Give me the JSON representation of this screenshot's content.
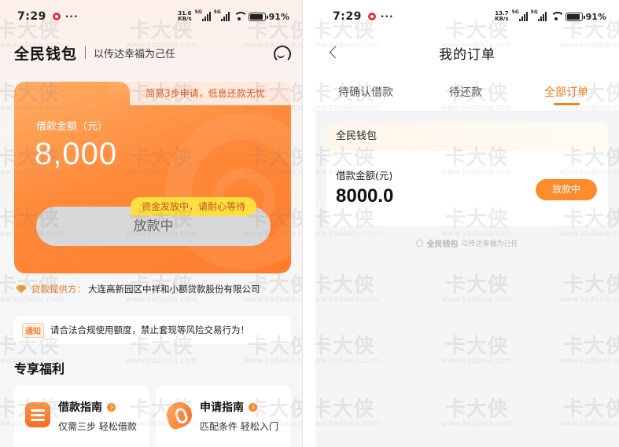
{
  "left_screen": {
    "status": {
      "time": "7:29",
      "more": "···",
      "speed_top": "31.6",
      "speed_bottom": "KB/s",
      "signal1_label": "5G",
      "signal2_label": "5G",
      "battery": "91",
      "battery_level": 0.91
    },
    "brand": "全民钱包",
    "slogan": "以传达幸福为己任",
    "card": {
      "tab_text": "简易3步申请，低息还款无忧",
      "amount_label": "借款金额（元）",
      "amount": "8,000",
      "hint": "资金发放中，请耐心等待",
      "button": "放款中"
    },
    "provider_label": "贷款提供方：",
    "provider_name": "大连高新园区中祥和小额贷款股份有限公司",
    "notice_tag": "通知",
    "notice_text": "请合法合规使用额度，禁止套现等风险交易行为！",
    "section_title": "专享福利",
    "tiles": [
      {
        "title": "借款指南",
        "sub": "仅需三步 轻松借款"
      },
      {
        "title": "申请指南",
        "sub": "匹配条件 轻松入门"
      }
    ]
  },
  "right_screen": {
    "status": {
      "time": "7:29",
      "more": "···",
      "speed_top": "13.7",
      "speed_bottom": "KB/s",
      "signal1_label": "5G",
      "signal2_label": "5G",
      "battery": "91",
      "battery_level": 0.91
    },
    "title": "我的订单",
    "tabs": [
      {
        "label": "待确认借款",
        "active": false
      },
      {
        "label": "待还款",
        "active": false
      },
      {
        "label": "全部订单",
        "active": true
      }
    ],
    "order": {
      "brand": "全民钱包",
      "amount_label": "借款金额(元)",
      "amount": "8000.0",
      "status": "放款中"
    },
    "footer_brand": "全民钱包",
    "footer_slogan": "以传达幸福为己任"
  },
  "watermark": {
    "logo": "卡大侠",
    "url": "www.kadaxia.com"
  },
  "colors": {
    "accent": "#ff7a1a",
    "card_orange": "#ff8a3a",
    "hint_yellow": "#ffdf3f",
    "status_dot": "#e3313f"
  }
}
